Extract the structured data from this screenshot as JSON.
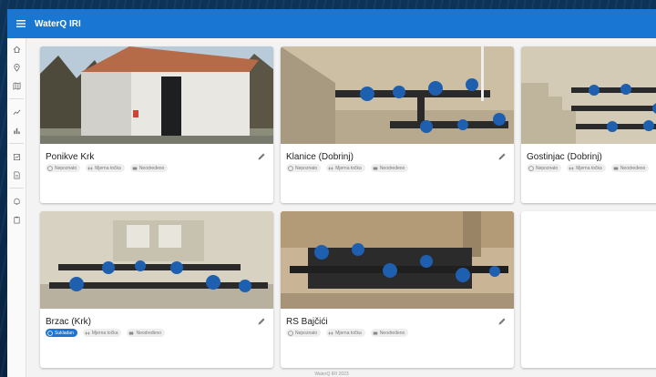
{
  "app": {
    "title": "WaterQ IRI"
  },
  "sidebar": {
    "items": [
      {
        "icon": "home-icon"
      },
      {
        "icon": "location-icon"
      },
      {
        "icon": "map-icon"
      },
      {
        "icon": "trend-icon"
      },
      {
        "icon": "bar-chart-icon"
      },
      {
        "icon": "report-icon"
      },
      {
        "icon": "document-icon"
      },
      {
        "icon": "alert-icon"
      },
      {
        "icon": "clipboard-icon"
      }
    ]
  },
  "cards": [
    {
      "title": "Ponikve Krk",
      "image": "building-photo",
      "chips": [
        {
          "icon": "status-icon",
          "label": "Nepoznato",
          "active": false
        },
        {
          "icon": "measure-point-icon",
          "label": "Mjerna točka",
          "active": false
        },
        {
          "icon": "sensor-icon",
          "label": "Neodređeno",
          "active": false
        }
      ]
    },
    {
      "title": "Klanice (Dobrinj)",
      "image": "pipes-photo",
      "chips": [
        {
          "icon": "status-icon",
          "label": "Nepoznato",
          "active": false
        },
        {
          "icon": "measure-point-icon",
          "label": "Mjerna točka",
          "active": false
        },
        {
          "icon": "sensor-icon",
          "label": "Neodređeno",
          "active": false
        }
      ]
    },
    {
      "title": "Gostinjac (Dobrinj)",
      "image": "pipes-stairs-photo",
      "chips": [
        {
          "icon": "status-icon",
          "label": "Nepoznato",
          "active": false
        },
        {
          "icon": "measure-point-icon",
          "label": "Mjerna točka",
          "active": false
        },
        {
          "icon": "sensor-icon",
          "label": "Neodređeno",
          "active": false
        }
      ]
    },
    {
      "title": "Brzac (Krk)",
      "image": "pump-room-photo",
      "chips": [
        {
          "icon": "status-icon",
          "label": "Sukladan",
          "active": true
        },
        {
          "icon": "measure-point-icon",
          "label": "Mjerna točka",
          "active": false
        },
        {
          "icon": "sensor-icon",
          "label": "Neodređeno",
          "active": false
        }
      ]
    },
    {
      "title": "RS Bajčići",
      "image": "valves-photo",
      "chips": [
        {
          "icon": "status-icon",
          "label": "Nepoznato",
          "active": false
        },
        {
          "icon": "measure-point-icon",
          "label": "Mjerna točka",
          "active": false
        },
        {
          "icon": "sensor-icon",
          "label": "Neodređeno",
          "active": false
        }
      ]
    }
  ],
  "add_card": {
    "label": "+"
  },
  "footer": {
    "text": "WaterQ IRI 2023"
  },
  "colors": {
    "primary": "#1976d2",
    "background": "#f3f3f3"
  }
}
